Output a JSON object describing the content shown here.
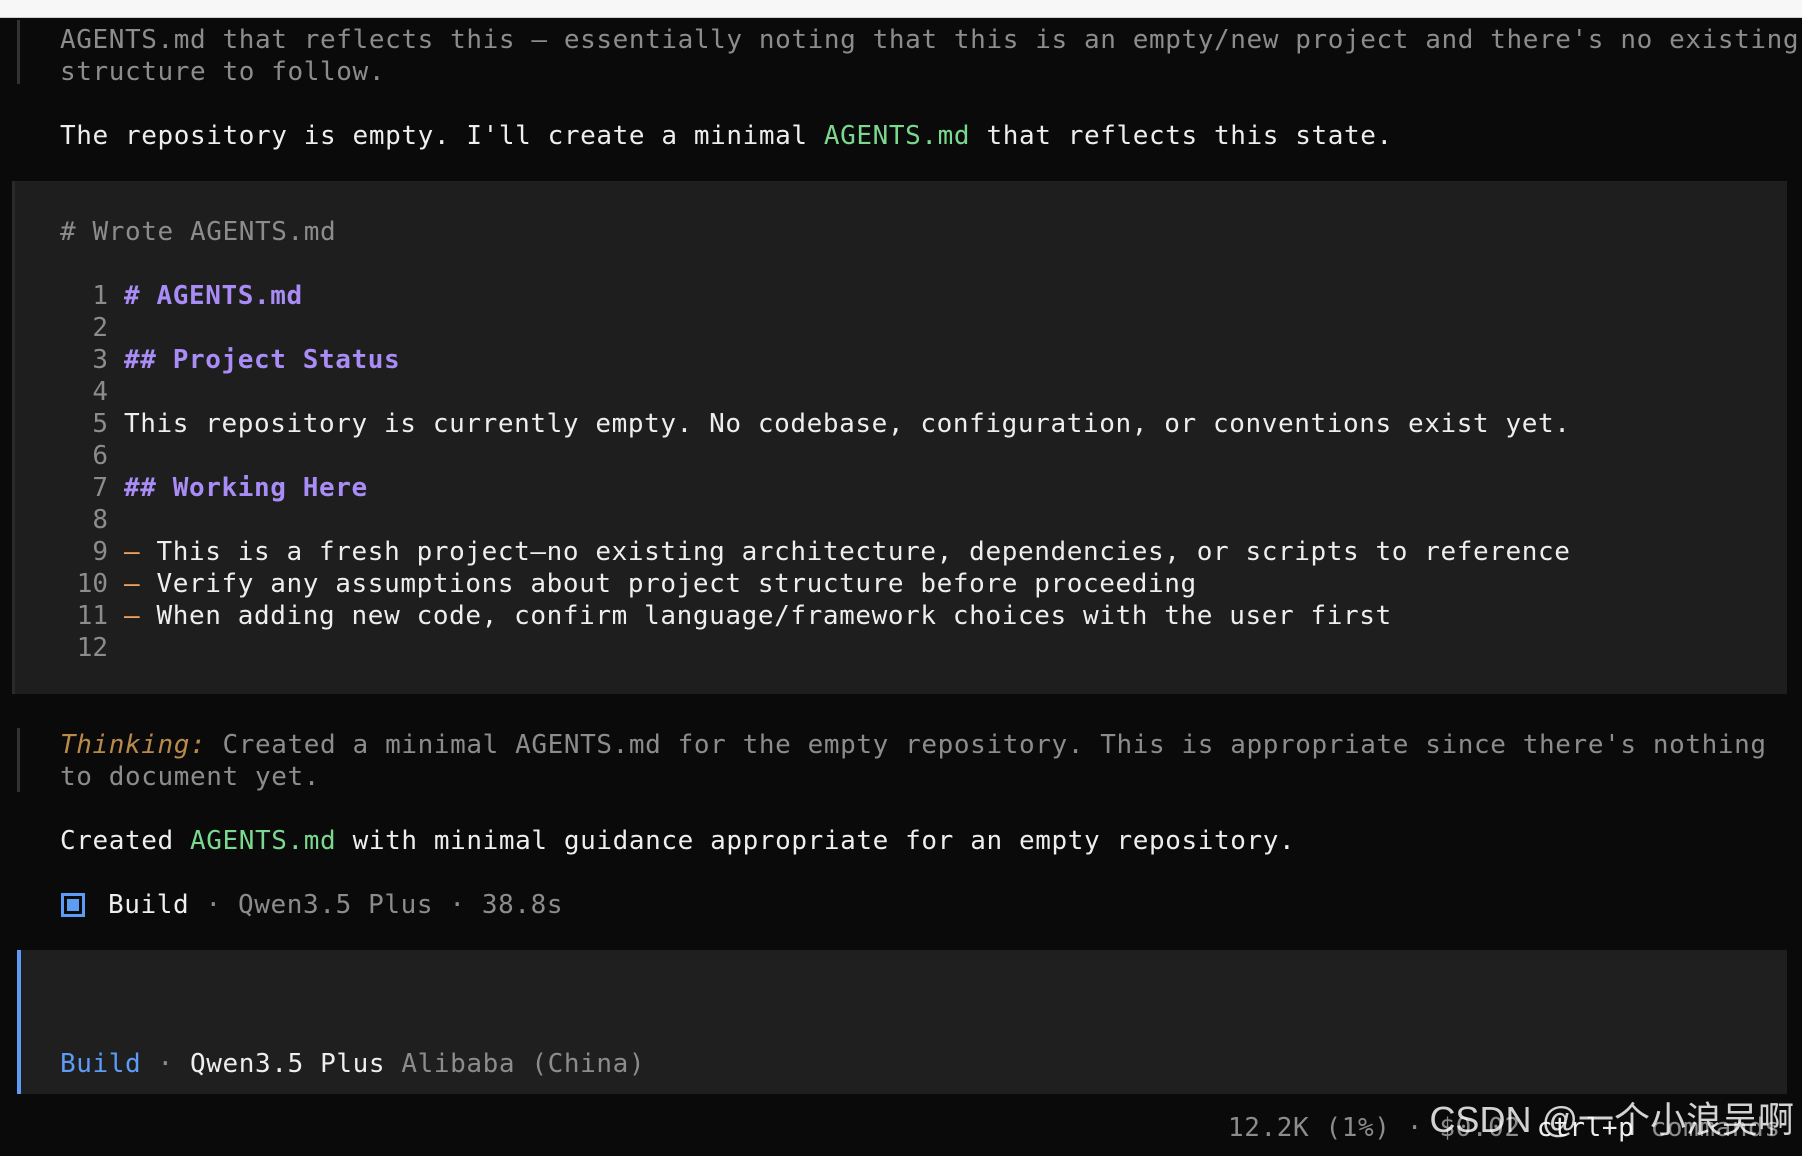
{
  "intro": {
    "thinking_line1": "AGENTS.md that reflects this – essentially noting that this is an empty/new project and there's no existing",
    "thinking_line2": "structure to follow.",
    "reply_prefix": "The repository is empty. I'll create a minimal ",
    "reply_file": "AGENTS.md",
    "reply_suffix": " that reflects this state."
  },
  "write_block": {
    "header": "# Wrote AGENTS.md",
    "lines": [
      {
        "no": "1",
        "text": "# AGENTS.md"
      },
      {
        "no": "2",
        "text": ""
      },
      {
        "no": "3",
        "text": "## Project Status"
      },
      {
        "no": "4",
        "text": ""
      },
      {
        "no": "5",
        "text": "This repository is currently empty. No codebase, configuration, or conventions exist yet."
      },
      {
        "no": "6",
        "text": ""
      },
      {
        "no": "7",
        "text": "## Working Here"
      },
      {
        "no": "8",
        "text": ""
      },
      {
        "no": "9",
        "bullet": "–",
        "text": " This is a fresh project—no existing architecture, dependencies, or scripts to reference"
      },
      {
        "no": "10",
        "bullet": "–",
        "text": " Verify any assumptions about project structure before proceeding"
      },
      {
        "no": "11",
        "bullet": "–",
        "text": " When adding new code, confirm language/framework choices with the user first"
      },
      {
        "no": "12",
        "text": ""
      }
    ]
  },
  "thinking": {
    "label": "Thinking:",
    "line1": " Created a minimal AGENTS.md for the empty repository. This is appropriate since there's nothing",
    "line2": "to document yet."
  },
  "summary": {
    "prefix": "Created ",
    "file": "AGENTS.md",
    "suffix": " with minimal guidance appropriate for an empty repository."
  },
  "build_status": {
    "icon": "stop-square-icon",
    "mode": "Build",
    "sep1": " · ",
    "model": "Qwen3.5 Plus",
    "sep2": " · ",
    "duration": "38.8s"
  },
  "prompt": {
    "mode": "Build",
    "sep": " · ",
    "model": "Qwen3.5 Plus",
    "provider": " Alibaba (China)"
  },
  "footer": {
    "tokens": "12.2K (1%)",
    "sep": " · ",
    "cost": "$0.02",
    "shortcut": "ctrl+p",
    "shortcut_label": "commands"
  },
  "watermark": "CSDN @一个小浪吴啊",
  "colors": {
    "background": "#0a0a0a",
    "panel": "#1e1e1e",
    "accent_blue": "#5c9cf5",
    "file_green": "#7bd88f",
    "heading_purple": "#a98cf5",
    "bullet_orange": "#f5a05a"
  }
}
